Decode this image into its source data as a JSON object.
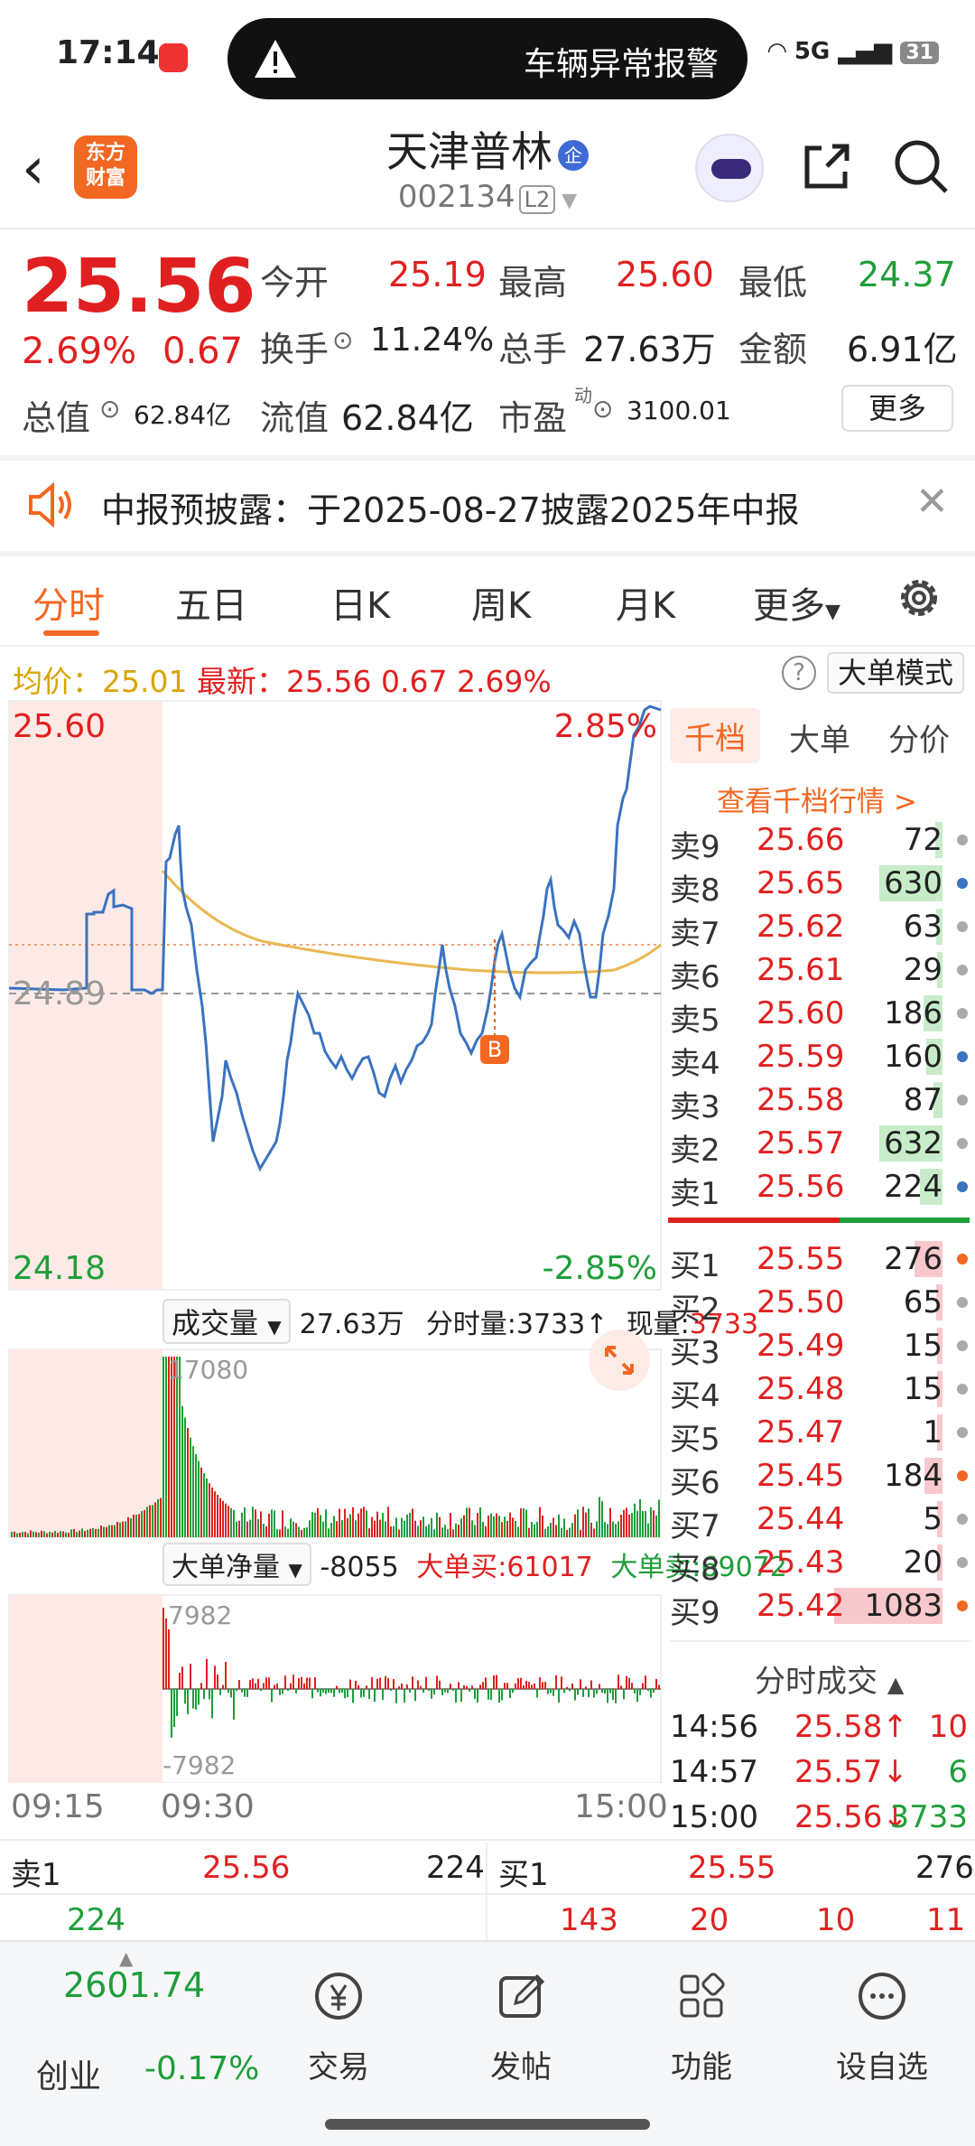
{
  "status_bar": {
    "time": "17:14",
    "pill_text": "车辆异常报警",
    "network": "5G",
    "battery": "31"
  },
  "header": {
    "title": "天津普林",
    "corp_badge": "企",
    "code": "002134",
    "level": "L2"
  },
  "quote": {
    "price": "25.56",
    "pct": "2.69%",
    "change": "0.67",
    "open_label": "今开",
    "open": "25.19",
    "high_label": "最高",
    "high": "25.60",
    "low_label": "最低",
    "low": "24.37",
    "turnover_label": "换手",
    "turnover": "11.24%",
    "volume_label": "总手",
    "volume": "27.63万",
    "amount_label": "金额",
    "amount": "6.91亿",
    "mktcap_label": "总值",
    "mktcap": "62.84亿",
    "float_label": "流值",
    "float": "62.84亿",
    "pe_label": "市盈",
    "pe_sup": "动",
    "pe": "3100.01",
    "more": "更多"
  },
  "notice": {
    "text": "中报预披露：于2025-08-27披露2025年中报"
  },
  "tabs": [
    "分时",
    "五日",
    "日K",
    "周K",
    "月K",
    "更多"
  ],
  "avg_bar": {
    "avg_label": "均价：",
    "avg": "25.01",
    "last_label": "最新：",
    "last": "25.56",
    "chg": "0.67",
    "pct": "2.69%",
    "mode": "大单模式",
    "help": "?"
  },
  "intraday": {
    "top_price": "25.60",
    "bottom_price": "24.18",
    "top_pct": "2.85%",
    "bottom_pct": "-2.85%",
    "ref_price": "24.89",
    "marker": "B",
    "volume_head": {
      "selector": "成交量",
      "total": "27.63万",
      "tick_label": "分时量:3733↑",
      "now_label": "现量:",
      "now": "3733",
      "max": "17080"
    },
    "net_head": {
      "selector": "大单净量",
      "value": "-8055",
      "buy_label": "大单买:",
      "buy": "61017",
      "sell_label": "大单卖:",
      "sell": "69072",
      "max": "7982",
      "min": "-7982"
    },
    "times": [
      "09:15",
      "09:30",
      "15:00"
    ]
  },
  "orderbook": {
    "tabs": [
      "千档",
      "大单",
      "分价"
    ],
    "link": "查看千档行情 >",
    "asks": [
      {
        "label": "卖9",
        "price": "25.66",
        "vol": "72"
      },
      {
        "label": "卖8",
        "price": "25.65",
        "vol": "630"
      },
      {
        "label": "卖7",
        "price": "25.62",
        "vol": "63"
      },
      {
        "label": "卖6",
        "price": "25.61",
        "vol": "29"
      },
      {
        "label": "卖5",
        "price": "25.60",
        "vol": "186"
      },
      {
        "label": "卖4",
        "price": "25.59",
        "vol": "160"
      },
      {
        "label": "卖3",
        "price": "25.58",
        "vol": "87"
      },
      {
        "label": "卖2",
        "price": "25.57",
        "vol": "632"
      },
      {
        "label": "卖1",
        "price": "25.56",
        "vol": "224"
      }
    ],
    "bids": [
      {
        "label": "买1",
        "price": "25.55",
        "vol": "276"
      },
      {
        "label": "买2",
        "price": "25.50",
        "vol": "65"
      },
      {
        "label": "买3",
        "price": "25.49",
        "vol": "15"
      },
      {
        "label": "买4",
        "price": "25.48",
        "vol": "15"
      },
      {
        "label": "买5",
        "price": "25.47",
        "vol": "1"
      },
      {
        "label": "买6",
        "price": "25.45",
        "vol": "184"
      },
      {
        "label": "买7",
        "price": "25.44",
        "vol": "5"
      },
      {
        "label": "买8",
        "price": "25.43",
        "vol": "20"
      },
      {
        "label": "买9",
        "price": "25.42",
        "vol": "1083"
      }
    ],
    "trades_title": "分时成交",
    "trades": [
      {
        "time": "14:56",
        "price": "25.58↑",
        "vol": "10"
      },
      {
        "time": "14:57",
        "price": "25.57↓",
        "vol": "6"
      },
      {
        "time": "15:00",
        "price": "25.56↓",
        "vol": "3733"
      }
    ]
  },
  "bottom_book": {
    "sell_label": "卖1",
    "sell_price": "25.56",
    "sell_vol": "224",
    "sell_detail": "224",
    "buy_label": "买1",
    "buy_price": "25.55",
    "buy_vol": "276",
    "buy_detail": [
      "143",
      "20",
      "10",
      "11"
    ]
  },
  "nav": {
    "index_value": "2601.74",
    "index_name": "创业",
    "index_change": "-0.17%",
    "items": [
      "交易",
      "发帖",
      "功能",
      "设自选"
    ]
  }
}
